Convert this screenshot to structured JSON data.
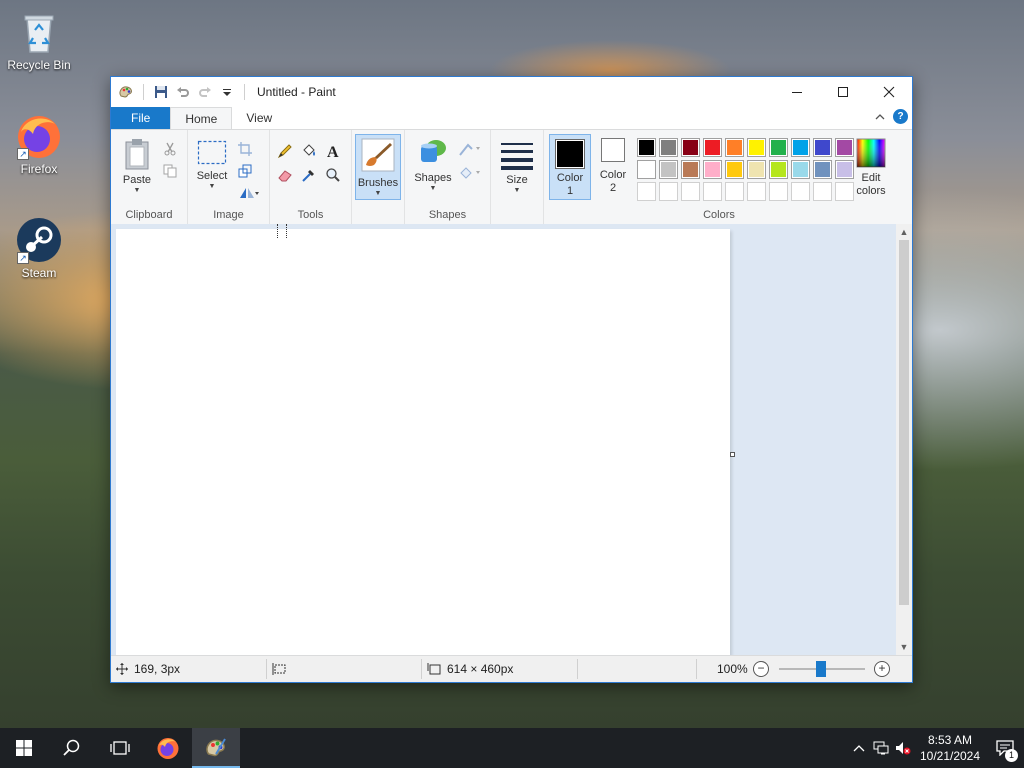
{
  "desktop": {
    "icons": [
      {
        "label": "Recycle Bin",
        "icon": "recycle-bin-icon"
      },
      {
        "label": "Firefox",
        "icon": "firefox-icon"
      },
      {
        "label": "Steam",
        "icon": "steam-icon"
      }
    ]
  },
  "window": {
    "title": "Untitled - Paint",
    "tabs": [
      "File",
      "Home",
      "View"
    ],
    "active_tab": "Home"
  },
  "ribbon": {
    "clipboard": {
      "label": "Clipboard",
      "paste_label": "Paste"
    },
    "image": {
      "label": "Image",
      "select_label": "Select"
    },
    "tools": {
      "label": "Tools"
    },
    "brushes_label": "Brushes",
    "shapes": {
      "label": "Shapes",
      "shapes_label": "Shapes"
    },
    "size_label": "Size",
    "colors": {
      "label": "Colors",
      "color1_line1": "Color",
      "color1_line2": "1",
      "color2_line1": "Color",
      "color2_line2": "2",
      "edit_line1": "Edit",
      "edit_line2": "colors",
      "color1_value": "#000000",
      "color2_value": "#ffffff",
      "palette_row1": [
        "#000000",
        "#7f7f7f",
        "#880015",
        "#ed1c24",
        "#ff7f27",
        "#fff200",
        "#22b14c",
        "#00a2e8",
        "#3f48cc",
        "#a349a4"
      ],
      "palette_row2": [
        "#ffffff",
        "#c3c3c3",
        "#b97a57",
        "#ffaec9",
        "#ffc90e",
        "#efe4b0",
        "#b5e61d",
        "#99d9ea",
        "#7092be",
        "#c8bfe7"
      ],
      "palette_row3": [
        "#ffffff",
        "#ffffff",
        "#ffffff",
        "#ffffff",
        "#ffffff",
        "#ffffff",
        "#ffffff",
        "#ffffff",
        "#ffffff",
        "#ffffff"
      ]
    }
  },
  "status": {
    "cursor_pos": "169, 3px",
    "canvas_size": "614 × 460px",
    "zoom": "100%"
  },
  "taskbar": {
    "time": "8:53 AM",
    "date": "10/21/2024",
    "notification_count": "1"
  }
}
